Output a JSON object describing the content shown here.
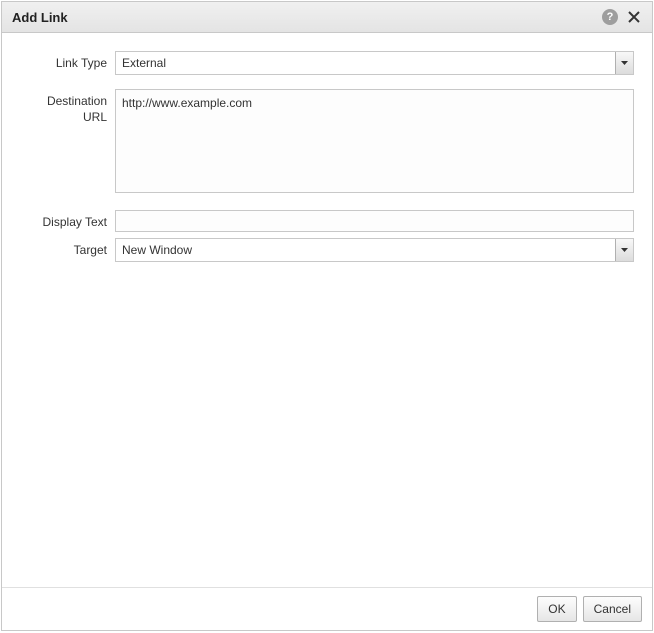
{
  "dialog": {
    "title": "Add Link"
  },
  "form": {
    "link_type": {
      "label": "Link Type",
      "value": "External"
    },
    "destination_url": {
      "label": "Destination URL",
      "value": "http://www.example.com"
    },
    "display_text": {
      "label": "Display Text",
      "value": ""
    },
    "target": {
      "label": "Target",
      "value": "New Window"
    }
  },
  "footer": {
    "ok": "OK",
    "cancel": "Cancel"
  }
}
